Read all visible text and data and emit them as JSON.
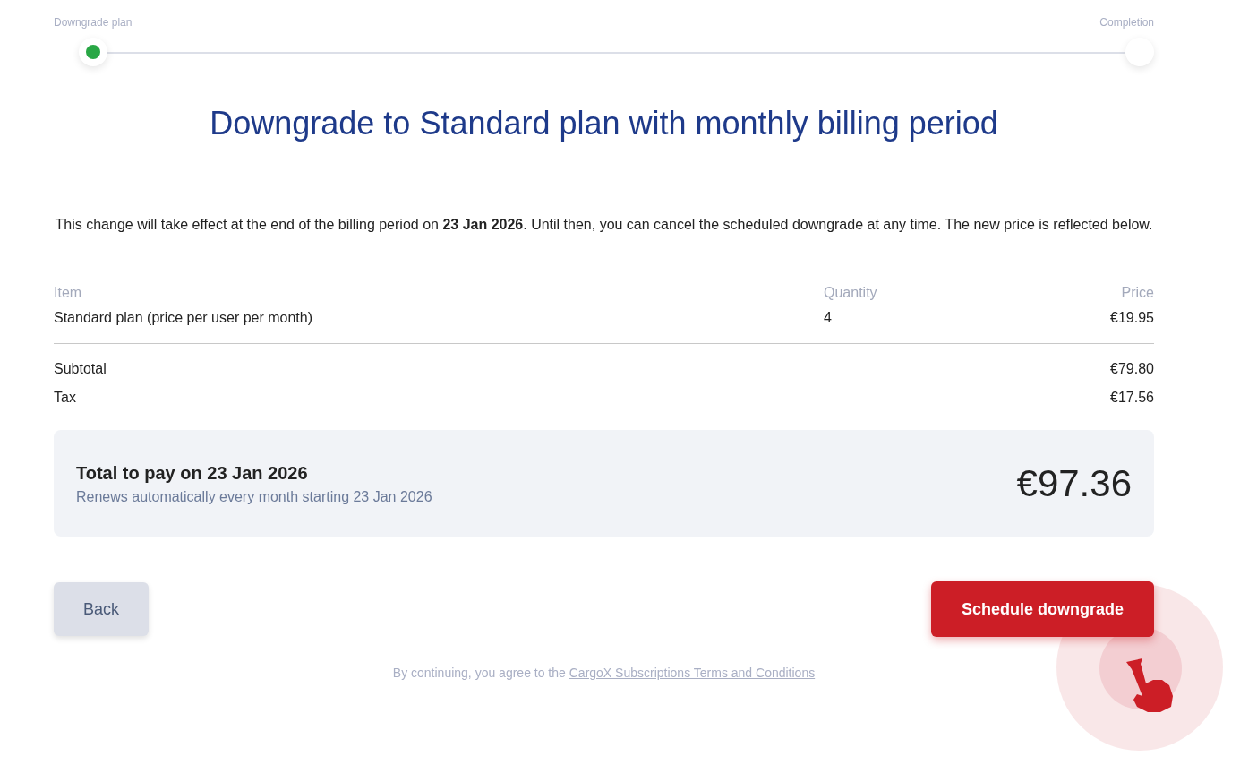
{
  "steps": [
    {
      "label": "Downgrade plan",
      "selected": true
    },
    {
      "label": "Completion",
      "selected": false
    }
  ],
  "title": "Downgrade to Standard plan with monthly billing period",
  "description": "This change will take effect at the end of the billing period on **23 Jan 2026**. Until then, you can cancel the scheduled downgrade at any time. The new price is reflected below.",
  "table": {
    "columns": [
      "Item",
      "Quantity",
      "Price"
    ],
    "rows": [
      [
        "Standard plan (price per user per month)",
        "4",
        "€19.95"
      ]
    ]
  },
  "summary": [
    {
      "label": "Subtotal",
      "value": "€79.80"
    },
    {
      "label": "Tax",
      "value": "€17.56"
    }
  ],
  "total": {
    "title": "Total to pay on 23 Jan 2026",
    "subtitle": "Renews automatically every month starting 23 Jan 2026",
    "amount": "€97.36"
  },
  "buttons": {
    "back": "Back",
    "primary": "Schedule downgrade"
  },
  "footer": {
    "text": "By continuing, you agree to the ",
    "link": "CargoX Subscriptions Terms and Conditions"
  }
}
